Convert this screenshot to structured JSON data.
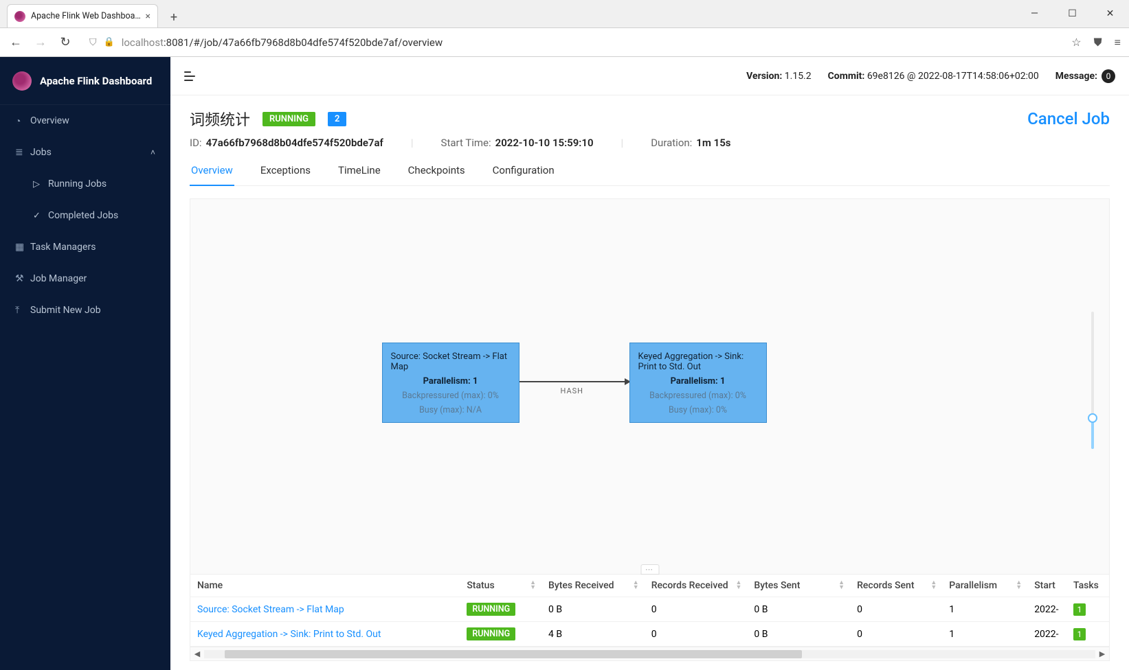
{
  "browser": {
    "tab_title": "Apache Flink Web Dashboard",
    "url": {
      "host_prefix": "localhost",
      "rest": ":8081/#/job/47a66fb7968d8b04dfe574f520bde7af/overview"
    }
  },
  "sidebar": {
    "title": "Apache Flink Dashboard",
    "items": {
      "overview": "Overview",
      "jobs": "Jobs",
      "running": "Running Jobs",
      "completed": "Completed Jobs",
      "task_managers": "Task Managers",
      "job_manager": "Job Manager",
      "submit": "Submit New Job"
    }
  },
  "topbar": {
    "version_label": "Version:",
    "version": "1.15.2",
    "commit_label": "Commit:",
    "commit": "69e8126 @ 2022-08-17T14:58:06+02:00",
    "message_label": "Message:",
    "message_count": "0"
  },
  "job": {
    "name": "词频统计",
    "status": "RUNNING",
    "count": "2",
    "id_label": "ID:",
    "id": "47a66fb7968d8b04dfe574f520bde7af",
    "start_label": "Start Time:",
    "start": "2022-10-10 15:59:10",
    "duration_label": "Duration:",
    "duration": "1m 15s",
    "cancel": "Cancel Job"
  },
  "tabs": {
    "overview": "Overview",
    "exceptions": "Exceptions",
    "timeline": "TimeLine",
    "checkpoints": "Checkpoints",
    "configuration": "Configuration"
  },
  "graph": {
    "edge_label": "HASH",
    "node1": {
      "title": "Source: Socket Stream -> Flat Map",
      "parallelism": "Parallelism: 1",
      "bp": "Backpressured (max): 0%",
      "busy": "Busy (max): N/A"
    },
    "node2": {
      "title": "Keyed Aggregation -> Sink: Print to Std. Out",
      "parallelism": "Parallelism: 1",
      "bp": "Backpressured (max): 0%",
      "busy": "Busy (max): 0%"
    }
  },
  "table": {
    "headers": {
      "name": "Name",
      "status": "Status",
      "bytes_received": "Bytes Received",
      "records_received": "Records Received",
      "bytes_sent": "Bytes Sent",
      "records_sent": "Records Sent",
      "parallelism": "Parallelism",
      "start_time": "Start",
      "tasks": "Tasks"
    },
    "rows": [
      {
        "name": "Source: Socket Stream -> Flat Map",
        "status": "RUNNING",
        "bytes_received": "0 B",
        "records_received": "0",
        "bytes_sent": "0 B",
        "records_sent": "0",
        "parallelism": "1",
        "start_time": "2022-",
        "tasks": "1"
      },
      {
        "name": "Keyed Aggregation -> Sink: Print to Std. Out",
        "status": "RUNNING",
        "bytes_received": "4 B",
        "records_received": "0",
        "bytes_sent": "0 B",
        "records_sent": "0",
        "parallelism": "1",
        "start_time": "2022-",
        "tasks": "1"
      }
    ]
  }
}
